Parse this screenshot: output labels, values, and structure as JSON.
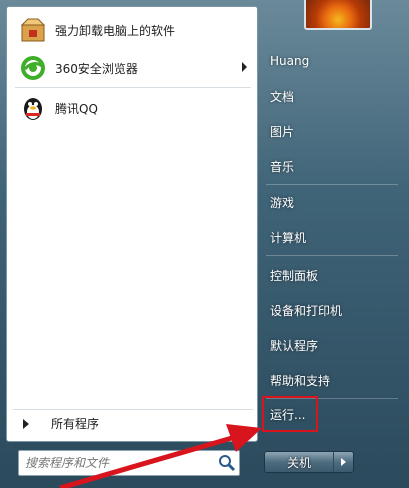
{
  "programs": [
    {
      "label": "强力卸载电脑上的软件",
      "icon": "uninstaller-box-icon",
      "has_submenu": false
    },
    {
      "label": "360安全浏览器",
      "icon": "360-browser-icon",
      "has_submenu": true
    },
    {
      "label": "腾讯QQ",
      "icon": "qq-penguin-icon",
      "has_submenu": false
    }
  ],
  "all_programs_label": "所有程序",
  "search": {
    "placeholder": "搜索程序和文件",
    "value": ""
  },
  "right_menu": [
    "Huang",
    "文档",
    "图片",
    "音乐",
    "游戏",
    "计算机",
    "控制面板",
    "设备和打印机",
    "默认程序",
    "帮助和支持",
    "运行..."
  ],
  "shutdown_label": "关机",
  "colors": {
    "annotation": "#d8141c",
    "highlight": "#d8141c"
  }
}
